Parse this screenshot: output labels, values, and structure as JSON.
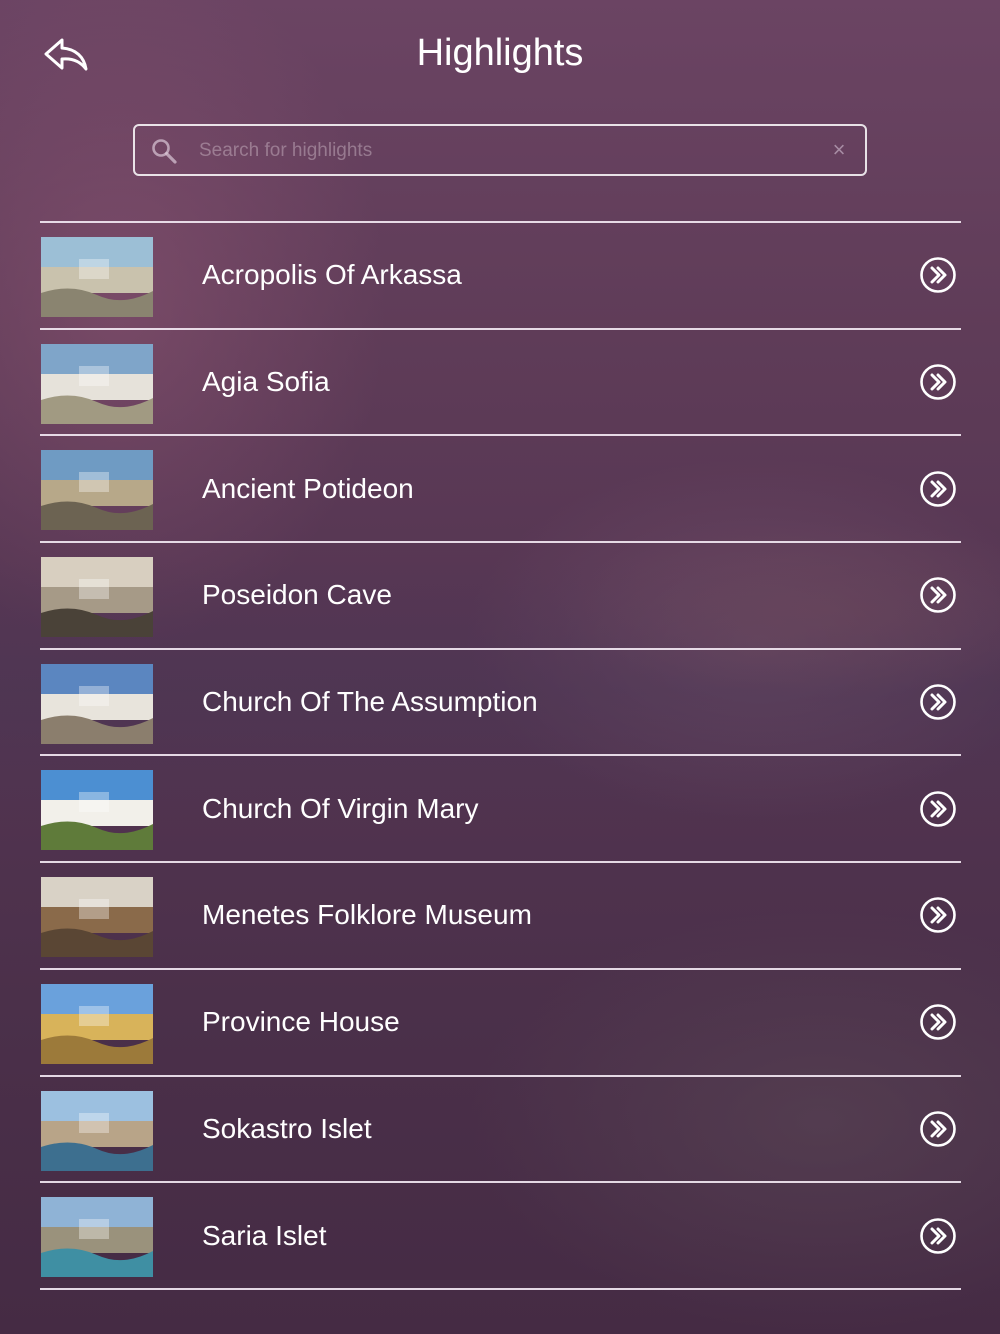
{
  "header": {
    "title": "Highlights",
    "back_icon": "back-arrow-icon"
  },
  "search": {
    "placeholder": "Search for highlights",
    "value": "",
    "clear_label": "×"
  },
  "items": [
    {
      "label": "Acropolis Of Arkassa",
      "thumb_colors": [
        "#9cbfd6",
        "#c9c2ad",
        "#8a8470"
      ]
    },
    {
      "label": "Agia Sofia",
      "thumb_colors": [
        "#7fa5c9",
        "#e6e2da",
        "#a19a82"
      ]
    },
    {
      "label": "Ancient Potideon",
      "thumb_colors": [
        "#6f9bc3",
        "#b7a889",
        "#6c6352"
      ]
    },
    {
      "label": "Poseidon Cave",
      "thumb_colors": [
        "#d8cfc0",
        "#a69a87",
        "#4a4238"
      ]
    },
    {
      "label": "Church Of The Assumption",
      "thumb_colors": [
        "#5b86c0",
        "#e8e4dc",
        "#8b7e6d"
      ]
    },
    {
      "label": "Church Of Virgin Mary",
      "thumb_colors": [
        "#4c8fd2",
        "#f2f0ea",
        "#5f7b3a"
      ]
    },
    {
      "label": "Menetes Folklore Museum",
      "thumb_colors": [
        "#d9d2c6",
        "#8a6a4a",
        "#5a4634"
      ]
    },
    {
      "label": "Province House",
      "thumb_colors": [
        "#6aa1dc",
        "#d8b35a",
        "#9c7a3a"
      ]
    },
    {
      "label": "Sokastro Islet",
      "thumb_colors": [
        "#9cc0e0",
        "#b8a488",
        "#3d6f8f"
      ]
    },
    {
      "label": "Saria Islet",
      "thumb_colors": [
        "#8fb3d6",
        "#9a927c",
        "#3f8fa3"
      ]
    }
  ]
}
